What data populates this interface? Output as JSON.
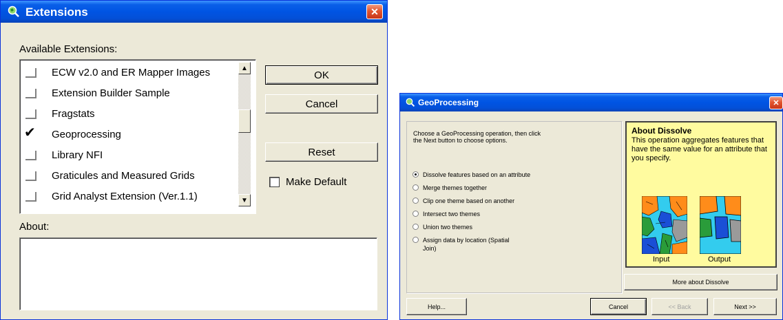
{
  "extensions_dialog": {
    "title": "Extensions",
    "close_glyph": "✕",
    "available_label": "Available Extensions:",
    "items": [
      {
        "name": "ECW v2.0 and ER Mapper Images",
        "checked": false
      },
      {
        "name": "Extension Builder Sample",
        "checked": false
      },
      {
        "name": "Fragstats",
        "checked": false
      },
      {
        "name": "Geoprocessing",
        "checked": true
      },
      {
        "name": "Library NFI",
        "checked": false
      },
      {
        "name": "Graticules and Measured Grids",
        "checked": false
      },
      {
        "name": "Grid Analyst Extension (Ver.1.1)",
        "checked": false
      }
    ],
    "check_glyph": "✔",
    "scroll_up_glyph": "▲",
    "scroll_down_glyph": "▼",
    "ok_label": "OK",
    "cancel_label": "Cancel",
    "reset_label": "Reset",
    "make_default_label": "Make Default",
    "make_default_checked": false,
    "about_label": "About:",
    "about_text": ""
  },
  "geoprocessing_dialog": {
    "title": "GeoProcessing",
    "close_glyph": "✕",
    "instructions": "Choose a GeoProcessing operation, then click the Next button to choose options.",
    "options": [
      {
        "label": "Dissolve features based on an attribute",
        "selected": true
      },
      {
        "label": "Merge themes together",
        "selected": false
      },
      {
        "label": "Clip one theme based on another",
        "selected": false
      },
      {
        "label": "Intersect two themes",
        "selected": false
      },
      {
        "label": "Union two themes",
        "selected": false
      },
      {
        "label": "Assign data by location (Spatial Join)",
        "selected": false
      }
    ],
    "about_title": "About Dissolve",
    "about_text": "This operation aggregates features that have the same value for an attribute that you specify.",
    "input_label": "Input",
    "output_label": "Output",
    "more_about_label": "More about Dissolve",
    "help_label": "Help...",
    "cancel_label": "Cancel",
    "back_label": "<< Back",
    "next_label": "Next >>"
  },
  "colors": {
    "title_blue": "#0054e3",
    "dialog_face": "#ece9d8",
    "about_yellow": "#fffb9f",
    "map_cyan": "#33ccee",
    "map_orange": "#ff8c1a",
    "map_green": "#2a9c3a",
    "map_blue": "#1a4fd6",
    "map_gray": "#9a9a9a"
  }
}
